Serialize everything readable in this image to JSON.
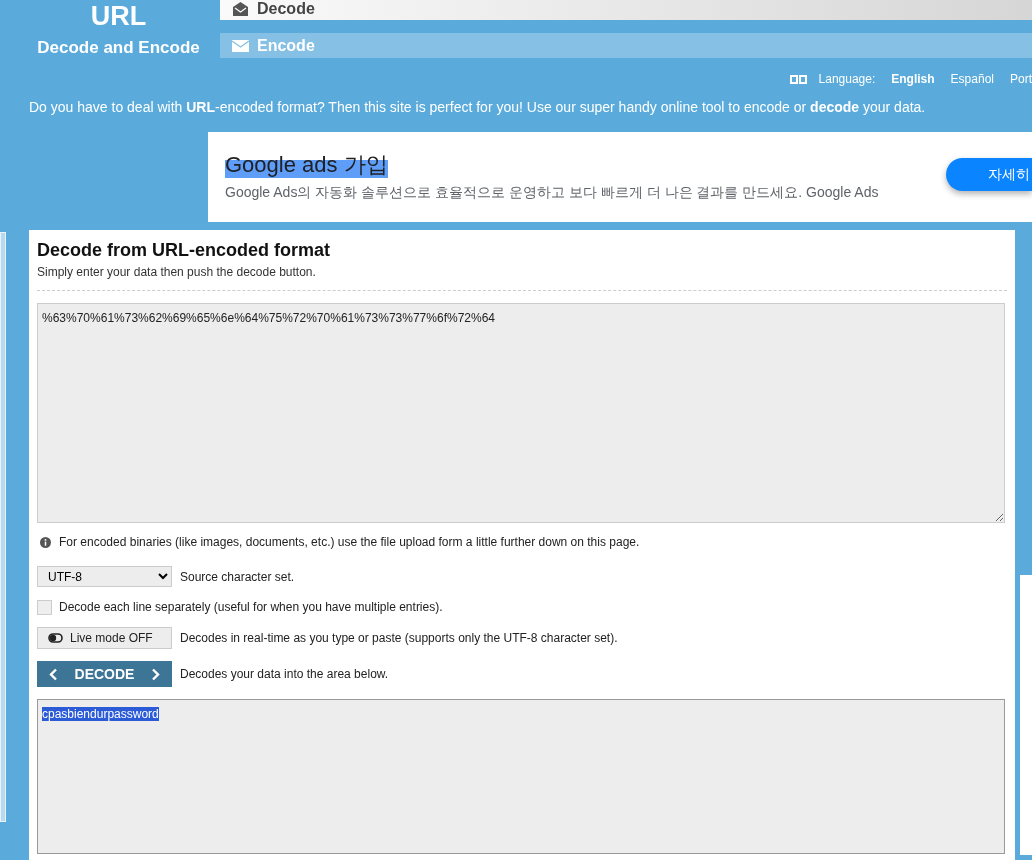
{
  "logo": {
    "title": "URL",
    "subtitle": "Decode and Encode"
  },
  "nav_tabs": [
    {
      "label": "Decode",
      "selected": true
    },
    {
      "label": "Encode",
      "selected": false
    }
  ],
  "language": {
    "label": "Language:",
    "options": [
      {
        "label": "English",
        "selected": true
      },
      {
        "label": "Español",
        "selected": false
      },
      {
        "label": "Port",
        "selected": false
      }
    ]
  },
  "intro": "Do you have to deal with **URL**-encoded format? Then this site is perfect for you! Use our super handy online tool to encode or **decode** your data.",
  "ad": {
    "title": "Google ads 가입",
    "title_selected": true,
    "description": "Google Ads의 자동화 솔루션으로 효율적으로 운영하고 보다 빠르게 더 나은 결과를 만드세요. Google Ads",
    "button": "자세히"
  },
  "panel": {
    "title": "Decode from URL-encoded format",
    "subtitle": "Simply enter your data then push the decode button.",
    "input_value": "%63%70%61%73%62%69%65%6e%64%75%72%70%61%73%73%77%6f%72%64",
    "info_note": "For encoded binaries (like images, documents, etc.) use the file upload form a little further down on this page.",
    "charset": {
      "value": "UTF-8",
      "hint": "Source character set."
    },
    "line_option": {
      "label": "Decode each line separately (useful for when you have multiple entries).",
      "checked": false
    },
    "live_mode": {
      "label": "Live mode OFF",
      "on": false,
      "hint": "Decodes in real-time as you type or paste (supports only the UTF-8 character set)."
    },
    "decode_button": {
      "label": "DECODE",
      "hint": "Decodes your data into the area below."
    },
    "output": {
      "value": "cpasbiendurpassword",
      "selected": true
    }
  }
}
